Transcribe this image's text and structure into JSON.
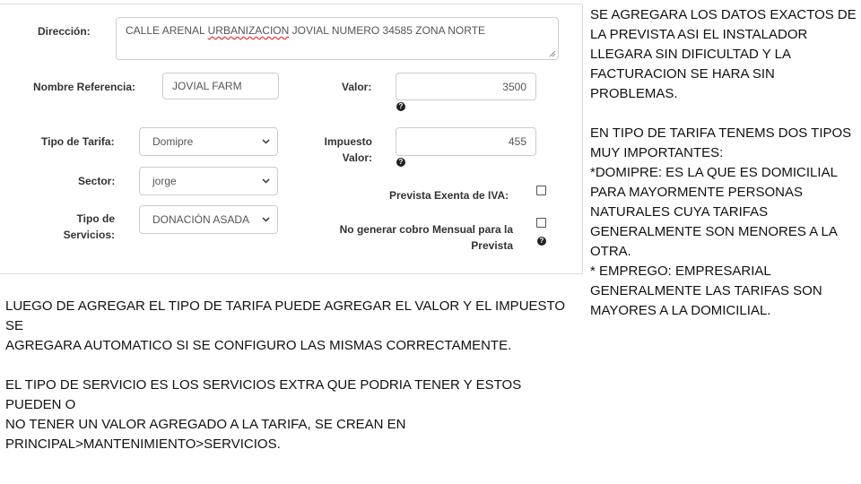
{
  "form": {
    "direccion": {
      "label": "Dirección:",
      "value_pre": "CALLE ARENAL ",
      "value_misspelled": "URBANIZACION",
      "value_post": " JOVIAL NUMERO 34585 ZONA NORTE"
    },
    "nombre_referencia": {
      "label": "Nombre Referencia:",
      "value": "JOVIAL FARM"
    },
    "valor": {
      "label": "Valor:",
      "value": "3500",
      "help": "?"
    },
    "tipo_tarifa": {
      "label": "Tipo de Tarifa:",
      "value": "Domipre"
    },
    "impuesto_valor": {
      "label_line1": "Impuesto",
      "label_line2": "Valor:",
      "value": "455",
      "help": "?"
    },
    "sector": {
      "label": "Sector:",
      "value": "jorge"
    },
    "prevista_exenta": {
      "label": "Prevista Exenta de IVA:",
      "checked": false
    },
    "tipo_servicios": {
      "label_line1": "Tipo de",
      "label_line2": "Servicios:",
      "value": "DONACIÓN ASADA"
    },
    "no_generar_cobro": {
      "label_line1": "No generar cobro Mensual para la",
      "label_line2": "Prevista",
      "checked": false,
      "help": "?"
    }
  },
  "notes": {
    "right": [
      "SE AGREGARA LOS DATOS EXACTOS DE",
      "LA PREVISTA ASI EL INSTALADOR",
      "LLEGARA SIN DIFICULTAD Y LA",
      "FACTURACION SE HARA SIN",
      "PROBLEMAS.",
      "",
      "EN TIPO DE TARIFA TENEMS DOS TIPOS",
      "MUY IMPORTANTES:",
      "*DOMIPRE: ES LA QUE ES DOMICILIAL",
      "PARA MAYORMENTE PERSONAS",
      "NATURALES CUYA TARIFAS",
      "GENERALMENTE SON MENORES A LA",
      "OTRA.",
      "* EMPREGO: EMPRESARIAL",
      "GENERALMENTE LAS TARIFAS SON",
      "MAYORES A LA DOMICILIAL."
    ],
    "bottom": [
      "LUEGO DE AGREGAR EL TIPO DE TARIFA PUEDE AGREGAR EL VALOR Y EL IMPUESTO SE",
      "AGREGARA AUTOMATICO SI SE CONFIGURO LAS MISMAS CORRECTAMENTE.",
      "",
      "EL TIPO DE SERVICIO ES LOS SERVICIOS EXTRA QUE PODRIA TENER Y ESTOS PUEDEN O",
      "NO TENER UN VALOR AGREGADO A LA TARIFA, SE CREAN EN",
      "PRINCIPAL>MANTENIMIENTO>SERVICIOS."
    ]
  }
}
